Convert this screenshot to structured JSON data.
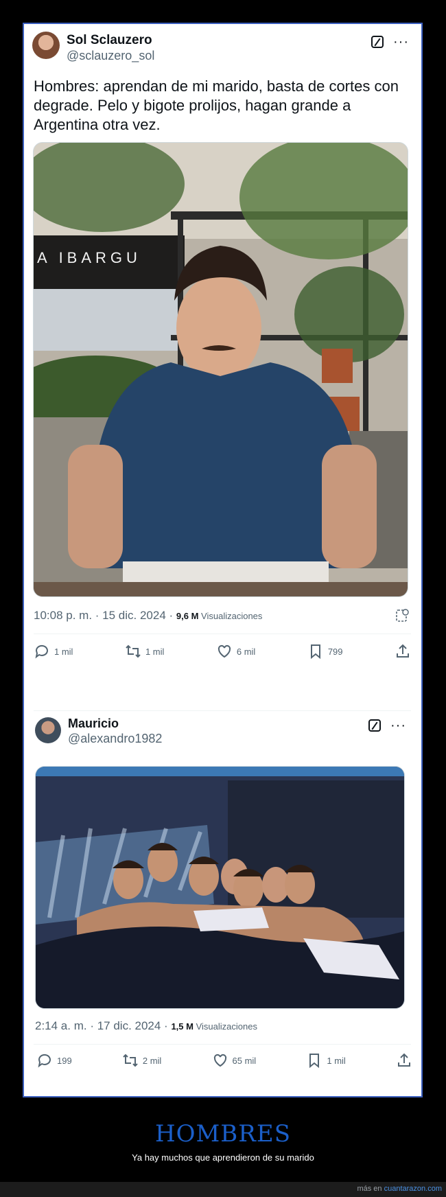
{
  "tweet1": {
    "name": "Sol Sclauzero",
    "handle": "@sclauzero_sol",
    "text": "Hombres: aprendan de mi marido, basta de cortes con degrade. Pelo y bigote prolijos, hagan grande a Argentina otra vez.",
    "photo_sign": "A IBARGU",
    "time": "10:08 p. m. · 15 dic. 2024 · ",
    "views_count": "9,6 M",
    "views_label": " Visualizaciones",
    "replies": "1 mil",
    "retweets": "1 mil",
    "likes": "6 mil",
    "bookmarks": "799"
  },
  "tweet2": {
    "name": "Mauricio",
    "handle": "@alexandro1982",
    "time": "2:14 a. m. · 17 dic. 2024 · ",
    "views_count": "1,5 M",
    "views_label": " Visualizaciones",
    "replies": "199",
    "retweets": "2 mil",
    "likes": "65 mil",
    "bookmarks": "1 mil"
  },
  "footer": {
    "title": "HOMBRES",
    "subtitle": "Ya hay muchos que aprendieron de su marido",
    "credit_prefix": "más en ",
    "credit_link": "cuantarazon.com"
  },
  "icons": [
    "grok-icon",
    "more-icon",
    "reply-icon",
    "retweet-icon",
    "like-icon",
    "bookmark-icon",
    "share-icon",
    "analytics-icon"
  ]
}
